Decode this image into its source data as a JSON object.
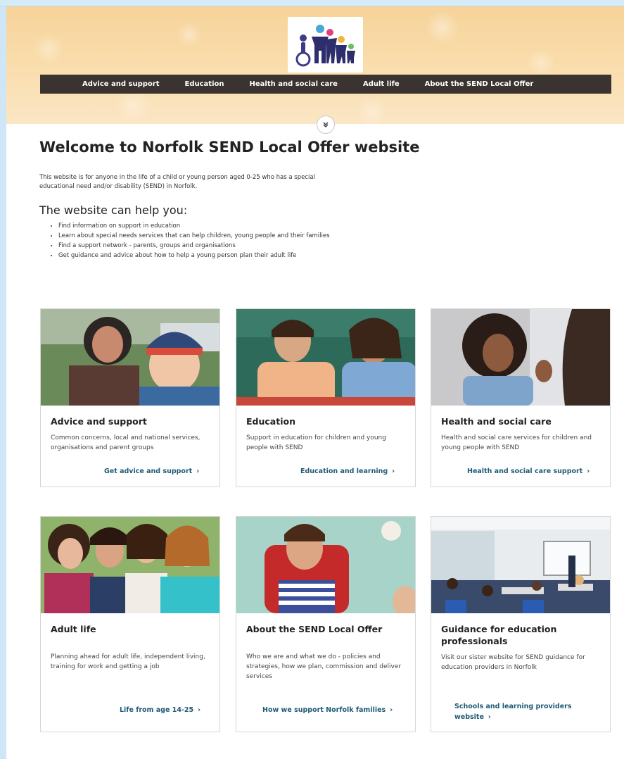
{
  "header": {
    "logo_alt": "Norfolk SEND Local Offer logo",
    "nav": [
      {
        "label": "Advice and support"
      },
      {
        "label": "Education"
      },
      {
        "label": "Health and social care"
      },
      {
        "label": "Adult life"
      },
      {
        "label": "About the SEND Local Offer"
      }
    ],
    "scroll_icon": "double-chevron-down-icon"
  },
  "main": {
    "title": "Welcome to Norfolk SEND Local Offer website",
    "intro": "This website is for anyone in the life of a child or young person aged 0-25 who has a special educational need and/or disability (SEND) in Norfolk.",
    "help_heading": "The website can help you:",
    "help_items": [
      "Find information on support in education",
      "Learn about special needs services that can help children, young people and their families",
      "Find a support network - parents, groups and organisations",
      "Get guidance and advice about how to help a young person plan their adult life"
    ]
  },
  "cards": [
    {
      "title": "Advice and support",
      "text": "Common concerns, local and national services, organisations and parent groups",
      "link": "Get advice and support",
      "image": "mother-and-child-photo"
    },
    {
      "title": "Education",
      "text": "Support in education for children and young people with SEND",
      "link": "Education and learning",
      "image": "teacher-and-pupil-photo"
    },
    {
      "title": "Health and social care",
      "text": "Health and social care services for children and young people with SEND",
      "link": "Health and social care support",
      "image": "child-signing-photo"
    },
    {
      "title": "Adult life",
      "text": "Planning ahead for adult life, independent living, training for work and getting a job",
      "link": "Life from age 14-25",
      "image": "group-of-young-people-photo"
    },
    {
      "title": "About the SEND Local Offer",
      "text": "Who we are and what we do - policies and strategies, how we plan, commission and deliver services",
      "link": "How we support Norfolk families",
      "image": "boy-in-wheelchair-photo"
    },
    {
      "title": "Guidance for education professionals",
      "text": "Visit our sister website for SEND guidance for education providers in Norfolk",
      "link": "Schools and learning providers website",
      "image": "classroom-photo"
    }
  ],
  "colors": {
    "nav_bg": "#3a3330",
    "link": "#1d5b75",
    "hero": "#f6d39a"
  }
}
